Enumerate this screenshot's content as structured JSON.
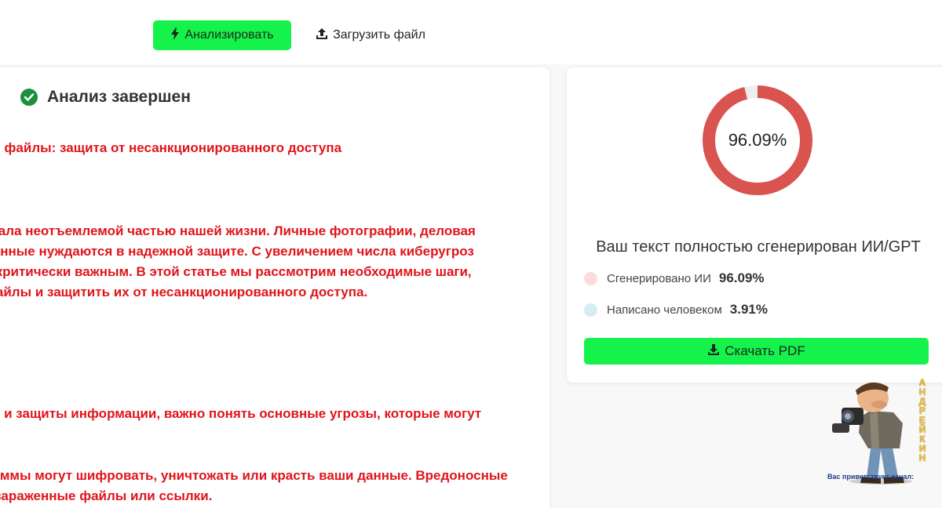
{
  "toolbar": {
    "analyze_label": "Анализировать",
    "upload_label": "Загрузить файл"
  },
  "result": {
    "status": "Анализ завершен",
    "lines": [
      "ои файлы: защита от несанкционированного доступа",
      "стала неотъемлемой частью нашей жизни. Личные фотографии, деловая",
      " данные нуждаются в надежной защите. С увеличением числа киберугроз",
      "я критически важным. В этой статье мы рассмотрим необходимые шаги,",
      "файлы и защитить их от несанкционированного доступа.",
      "ия и защиты информации, важно понять основные угрозы, которые могут",
      "раммы могут шифровать, уничтожать или красть ваши данные. Вредоносные",
      "з зараженные файлы или ссылки."
    ],
    "text_color": "#e0141a"
  },
  "summary": {
    "donut_value": 96.09,
    "donut_label": "96.09%",
    "donut_color": "#d9534f",
    "verdict": "Ваш текст полностью сгенерирован ИИ/GPT",
    "legend": [
      {
        "label": "Сгенерировано ИИ",
        "value": "96.09%",
        "color": "#fbdcdc"
      },
      {
        "label": "Написано человеком",
        "value": "3.91%",
        "color": "#d6ecf5"
      }
    ],
    "download_label": "Скачать PDF"
  },
  "watermark": {
    "caption": "Вас приветствует канал:",
    "vertical": "АНДРЕЙКИН"
  },
  "colors": {
    "accent": "#16f24c",
    "check": "#1e8f3e"
  }
}
